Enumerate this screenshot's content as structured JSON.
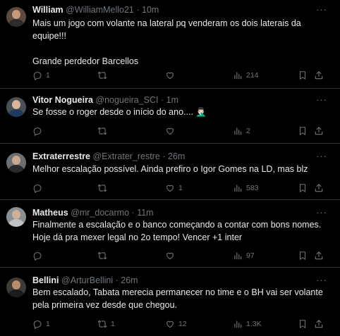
{
  "tweets": [
    {
      "name": "William",
      "handle": "@WilliamMello21",
      "time": "10m",
      "text": "Mais um jogo com volante na lateral pq venderam os dois laterais da equipe!!!\n\nGrande perdedor Barcellos",
      "replies": "1",
      "retweets": "",
      "likes": "",
      "views": "214",
      "avatar_colors": [
        "#5b4a3d",
        "#c49a7a",
        "#2c2c2c"
      ]
    },
    {
      "name": "Vitor Nogueira",
      "handle": "@nogueira_SCI",
      "time": "1m",
      "text": "Se fosse o roger desde o início do ano.... 🤦🏻‍♂️",
      "replies": "",
      "retweets": "",
      "likes": "",
      "views": "2",
      "avatar_colors": [
        "#4a4f55",
        "#d8b49a",
        "#1e3a5f"
      ]
    },
    {
      "name": "Extraterrestre",
      "handle": "@Extrater_restre",
      "time": "26m",
      "text": "Melhor escalação possível. Ainda prefiro o Igor Gomes na LD, mas blz",
      "replies": "",
      "retweets": "",
      "likes": "1",
      "views": "583",
      "avatar_colors": [
        "#6b7075",
        "#c8a88e",
        "#2a2a2a"
      ]
    },
    {
      "name": "Matheus",
      "handle": "@mr_docarmo",
      "time": "11m",
      "text": "Finalmente a escalação e o banco começando a contar com bons nomes. Hoje dá pra mexer legal no 2o tempo! Vencer +1 inter",
      "replies": "",
      "retweets": "",
      "likes": "",
      "views": "97",
      "avatar_colors": [
        "#8a8f94",
        "#d1b096",
        "#c0c4c8"
      ]
    },
    {
      "name": "Bellini",
      "handle": "@ArturBellini",
      "time": "26m",
      "text": "Bem escalado, Tabata merecia permanecer no time e o BH vai ser volante pela primeira vez desde que chegou.",
      "replies": "1",
      "retweets": "1",
      "likes": "12",
      "views": "1.3K",
      "avatar_colors": [
        "#3e3a36",
        "#b88d6c",
        "#1b1b1b"
      ]
    }
  ],
  "meta_separator": "·",
  "more_label": "···",
  "colors": {
    "text": "#e7e9ea",
    "muted": "#71767b",
    "border": "#2f3336",
    "background": "#000000"
  },
  "icons": [
    "reply-icon",
    "retweet-icon",
    "like-icon",
    "views-icon",
    "bookmark-icon",
    "share-icon",
    "more-icon"
  ]
}
